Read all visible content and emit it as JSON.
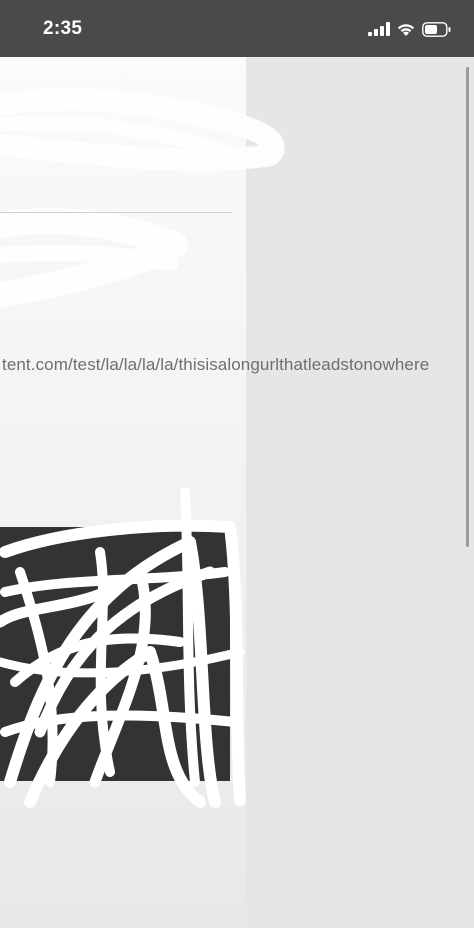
{
  "status_bar": {
    "time": "2:35",
    "icons": [
      "signal-icon",
      "wifi-icon",
      "battery-icon"
    ]
  },
  "page": {
    "url_text": "tent.com/test/la/la/la/la/thisisalongurlthatleadstonowhere"
  },
  "colors": {
    "status_bar_bg": "#4a4a4a",
    "panel_bg": "#f8f8f8",
    "outer_bg": "#e6e6e6",
    "dark_image": "#333333",
    "url_text": "#6e6e6e"
  }
}
